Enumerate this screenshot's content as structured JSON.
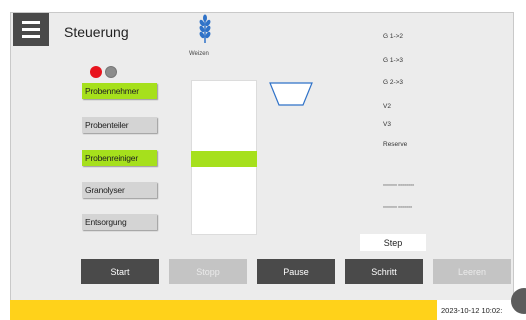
{
  "header": {
    "title": "Steuerung"
  },
  "product": {
    "icon": "wheat-icon",
    "label": "Weizen"
  },
  "indicators": [
    {
      "name": "red-indicator",
      "color": "#e8141e"
    },
    {
      "name": "grey-indicator",
      "color": "#8c8c8c"
    }
  ],
  "side_buttons": [
    {
      "label": "Probennehmer",
      "active": true
    },
    {
      "label": "Probenteiler",
      "active": false
    },
    {
      "label": "Probenreiniger",
      "active": true
    },
    {
      "label": "Granolyser",
      "active": false
    },
    {
      "label": "Entsorgung",
      "active": false
    }
  ],
  "status_list": [
    "G 1->2",
    "G 1->3",
    "G 2->3",
    "V2",
    "V3",
    "Reserve"
  ],
  "status_small": [
    "xxxxxxx xxxxxxxx",
    "xxxxxxx xxxxxxx"
  ],
  "step": {
    "label": "Step"
  },
  "controls": {
    "start": "Start",
    "stop": "Stopp",
    "pause": "Pause",
    "schritt": "Schritt",
    "leeren": "Leeren"
  },
  "footer": {
    "datetime": "2023-10-12 10:02:"
  },
  "colors": {
    "accent": "#a6e01c",
    "footer": "#ffd21a",
    "dark_button": "#4a4a4a"
  }
}
